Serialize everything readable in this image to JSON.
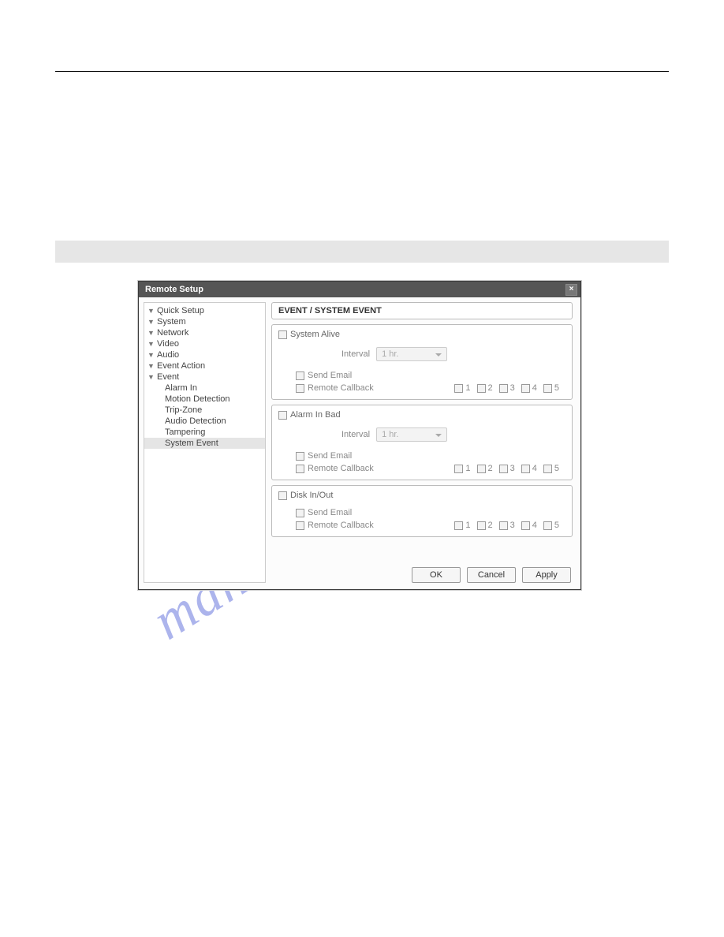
{
  "watermark": "manualshive.com",
  "window": {
    "title": "Remote Setup",
    "close": "×"
  },
  "tree": {
    "quick_setup": "Quick Setup",
    "system": "System",
    "network": "Network",
    "video": "Video",
    "audio": "Audio",
    "event_action": "Event Action",
    "event": "Event",
    "sub": {
      "alarm_in": "Alarm In",
      "motion": "Motion Detection",
      "trip_zone": "Trip-Zone",
      "audio_det": "Audio Detection",
      "tampering": "Tampering",
      "system_event": "System Event"
    }
  },
  "breadcrumb": "EVENT / SYSTEM EVENT",
  "labels": {
    "interval": "Interval",
    "send_email": "Send Email",
    "remote_callback": "Remote Callback",
    "hr": "1 hr."
  },
  "groups": {
    "system_alive": "System Alive",
    "alarm_in_bad": "Alarm In Bad",
    "disk_in_out": "Disk In/Out"
  },
  "numbers": {
    "n1": "1",
    "n2": "2",
    "n3": "3",
    "n4": "4",
    "n5": "5"
  },
  "buttons": {
    "ok": "OK",
    "cancel": "Cancel",
    "apply": "Apply"
  }
}
